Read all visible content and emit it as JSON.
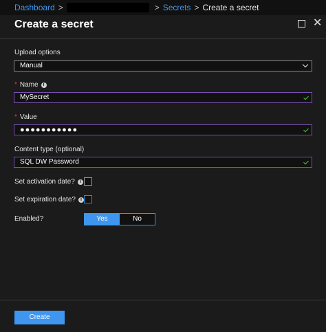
{
  "breadcrumb": {
    "items": [
      "Dashboard",
      "Secrets",
      "Create a secret"
    ]
  },
  "blade": {
    "title": "Create a secret",
    "maximize_icon": "maximize-icon",
    "close_icon": "close-icon",
    "close_glyph": "✕"
  },
  "form": {
    "upload_options": {
      "label": "Upload options",
      "value": "Manual"
    },
    "name": {
      "label": "Name",
      "value": "MySecret",
      "required_mark": "*",
      "info_glyph": "i"
    },
    "value": {
      "label": "Value",
      "value": "●●●●●●●●●●●",
      "required_mark": "*"
    },
    "content_type": {
      "label": "Content type (optional)",
      "value": "SQL DW Password"
    },
    "activation": {
      "label": "Set activation date?",
      "info_glyph": "i"
    },
    "expiration": {
      "label": "Set expiration date?",
      "info_glyph": "i"
    },
    "enabled": {
      "label": "Enabled?",
      "options": [
        "Yes",
        "No"
      ],
      "selected": "Yes"
    }
  },
  "footer": {
    "create_label": "Create"
  },
  "colors": {
    "accent": "#3e96f0",
    "valid_check": "#5ec143",
    "field_focus_border": "#7d50b5",
    "required": "#f03e3e"
  }
}
